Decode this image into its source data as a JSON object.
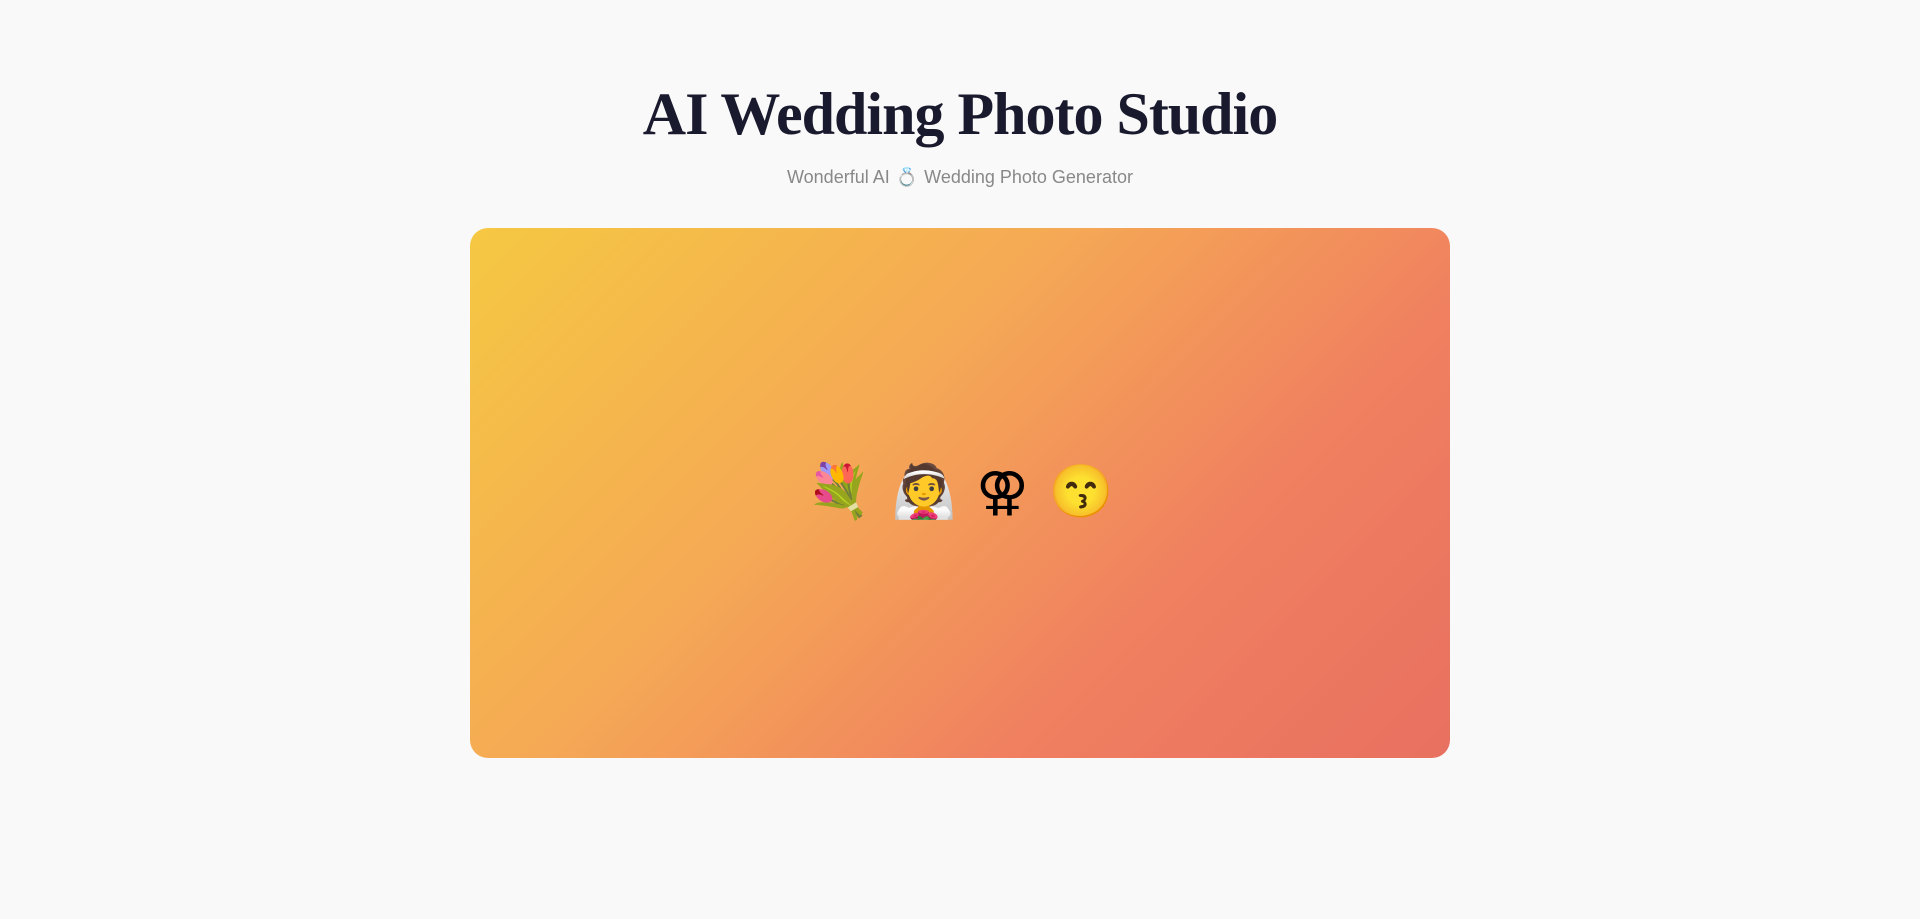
{
  "header": {
    "main_title": "AI Wedding Photo Studio",
    "subtitle_part1": "Wonderful AI",
    "subtitle_ring_emoji": "💍",
    "subtitle_part2": "Wedding Photo Generator"
  },
  "gradient_card": {
    "background_start": "#f5c842",
    "background_end": "#e87060",
    "emojis": [
      {
        "symbol": "💐",
        "label": "bouquet"
      },
      {
        "symbol": "👰",
        "label": "bride"
      },
      {
        "symbol": "♀️",
        "label": "female-sign"
      },
      {
        "symbol": "😙",
        "label": "kissing-face"
      }
    ]
  }
}
